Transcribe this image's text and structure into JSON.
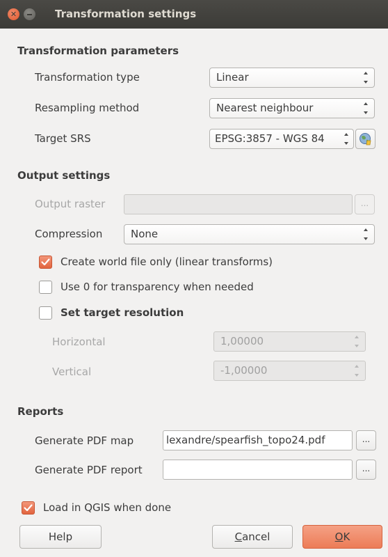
{
  "window": {
    "title": "Transformation settings"
  },
  "transformation_parameters": {
    "heading": "Transformation parameters",
    "type_label": "Transformation type",
    "type_value": "Linear",
    "resampling_label": "Resampling method",
    "resampling_value": "Nearest neighbour",
    "srs_label": "Target SRS",
    "srs_value": "EPSG:3857 - WGS 84"
  },
  "output_settings": {
    "heading": "Output settings",
    "output_raster_label": "Output raster",
    "output_raster_value": "",
    "browse_label": "...",
    "compression_label": "Compression",
    "compression_value": "None",
    "world_file_label": "Create world file only (linear transforms)",
    "world_file_checked": true,
    "transparency_label": "Use 0 for transparency when needed",
    "transparency_checked": false,
    "target_resolution_label": "Set target resolution",
    "target_resolution_checked": false,
    "horizontal_label": "Horizontal",
    "horizontal_value": "1,00000",
    "vertical_label": "Vertical",
    "vertical_value": "-1,00000"
  },
  "reports": {
    "heading": "Reports",
    "pdf_map_label": "Generate PDF map",
    "pdf_map_value": "lexandre/spearfish_topo24.pdf",
    "pdf_report_label": "Generate PDF report",
    "pdf_report_value": "",
    "browse_label": "..."
  },
  "load_in_qgis": {
    "label": "Load in QGIS when done",
    "checked": true
  },
  "buttons": {
    "help": "Help",
    "cancel_mnemonic": "C",
    "cancel_rest": "ancel",
    "ok_mnemonic": "O",
    "ok_rest": "K"
  },
  "colors": {
    "accent": "#E9734B",
    "titlebar": "#3C3B37",
    "background": "#F2F1F0"
  }
}
